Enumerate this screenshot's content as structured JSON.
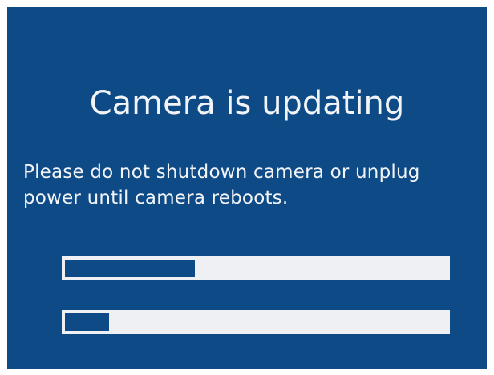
{
  "title": "Camera is updating",
  "message": {
    "line1": "Please do not shutdown camera or unplug",
    "line2": "power until camera reboots."
  },
  "progress_bars": [
    {
      "fraction": 0.34
    },
    {
      "fraction": 0.115
    }
  ],
  "colors": {
    "background": "#0d4a86",
    "text": "#f2f4f8",
    "bar_track": "#eef0f3",
    "bar_fill": "#0d4a86"
  }
}
